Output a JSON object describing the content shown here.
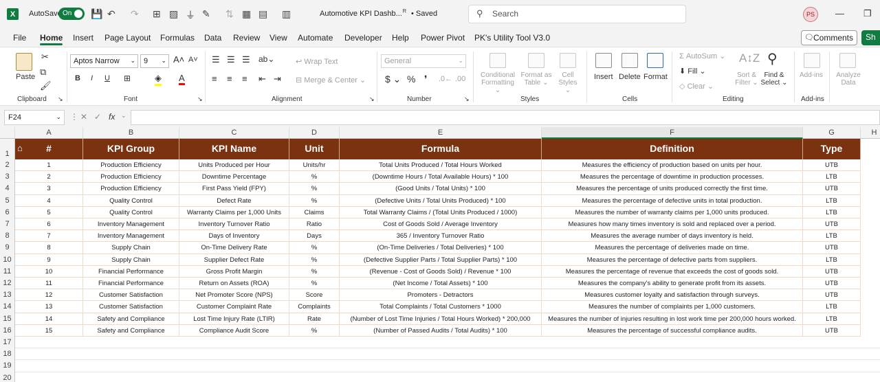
{
  "titlebar": {
    "logo": "X",
    "autosave_label": "AutoSave",
    "autosave_state": "On",
    "document_title": "Automotive KPI Dashb...",
    "saved_status": "• Saved",
    "search_placeholder": "Search",
    "avatar_initials": "PS"
  },
  "menu": [
    "File",
    "Home",
    "Insert",
    "Page Layout",
    "Formulas",
    "Data",
    "Review",
    "View",
    "Automate",
    "Developer",
    "Help",
    "Power Pivot",
    "PK's Utility Tool V3.0"
  ],
  "menu_active": "Home",
  "comments_label": "Comments",
  "share_label": "Sh",
  "ribbon": {
    "paste": "Paste",
    "clipboard": "Clipboard",
    "font_name": "Aptos Narrow",
    "font_size": "9",
    "font": "Font",
    "wrap_text": "Wrap Text",
    "merge_center": "Merge & Center",
    "alignment": "Alignment",
    "number_format": "General",
    "number": "Number",
    "conditional_formatting_1": "Conditional",
    "conditional_formatting_2": "Formatting",
    "format_as_table_1": "Format as",
    "format_as_table_2": "Table",
    "cell_styles_1": "Cell",
    "cell_styles_2": "Styles",
    "styles": "Styles",
    "insert": "Insert",
    "delete": "Delete",
    "format": "Format",
    "cells": "Cells",
    "autosum": "AutoSum",
    "fill": "Fill",
    "clear": "Clear",
    "sort_filter_1": "Sort &",
    "sort_filter_2": "Filter",
    "find_select_1": "Find &",
    "find_select_2": "Select",
    "editing": "Editing",
    "addins": "Add-ins",
    "addins_group": "Add-ins",
    "analyze_1": "Analyze",
    "analyze_2": "Data"
  },
  "namebox": "F24",
  "columns": [
    "A",
    "B",
    "C",
    "D",
    "E",
    "F",
    "G",
    "H"
  ],
  "table_headers": [
    "#",
    "KPI Group",
    "KPI Name",
    "Unit",
    "Formula",
    "Definition",
    "Type"
  ],
  "rows": [
    [
      "1",
      "Production Efficiency",
      "Units Produced per Hour",
      "Units/hr",
      "Total Units Produced / Total Hours Worked",
      "Measures the efficiency of production based on units per hour.",
      "UTB"
    ],
    [
      "2",
      "Production Efficiency",
      "Downtime Percentage",
      "%",
      "(Downtime Hours / Total Available Hours) * 100",
      "Measures the percentage of downtime in production processes.",
      "LTB"
    ],
    [
      "3",
      "Production Efficiency",
      "First Pass Yield (FPY)",
      "%",
      "(Good Units / Total Units) * 100",
      "Measures the percentage of units produced correctly the first time.",
      "UTB"
    ],
    [
      "4",
      "Quality Control",
      "Defect Rate",
      "%",
      "(Defective Units / Total Units Produced) * 100",
      "Measures the percentage of defective units in total production.",
      "LTB"
    ],
    [
      "5",
      "Quality Control",
      "Warranty Claims per 1,000 Units",
      "Claims",
      "Total Warranty Claims / (Total Units Produced / 1000)",
      "Measures the number of warranty claims per 1,000 units produced.",
      "LTB"
    ],
    [
      "6",
      "Inventory Management",
      "Inventory Turnover Ratio",
      "Ratio",
      "Cost of Goods Sold / Average Inventory",
      "Measures how many times inventory is sold and replaced over a period.",
      "UTB"
    ],
    [
      "7",
      "Inventory Management",
      "Days of Inventory",
      "Days",
      "365 / Inventory Turnover Ratio",
      "Measures the average number of days inventory is held.",
      "LTB"
    ],
    [
      "8",
      "Supply Chain",
      "On-Time Delivery Rate",
      "%",
      "(On-Time Deliveries / Total Deliveries) * 100",
      "Measures the percentage of deliveries made on time.",
      "UTB"
    ],
    [
      "9",
      "Supply Chain",
      "Supplier Defect Rate",
      "%",
      "(Defective Supplier Parts / Total Supplier Parts) * 100",
      "Measures the percentage of defective parts from suppliers.",
      "LTB"
    ],
    [
      "10",
      "Financial Performance",
      "Gross Profit Margin",
      "%",
      "(Revenue - Cost of Goods Sold) / Revenue * 100",
      "Measures the percentage of revenue that exceeds the cost of goods sold.",
      "UTB"
    ],
    [
      "11",
      "Financial Performance",
      "Return on Assets (ROA)",
      "%",
      "(Net Income / Total Assets) * 100",
      "Measures the company's ability to generate profit from its assets.",
      "UTB"
    ],
    [
      "12",
      "Customer Satisfaction",
      "Net Promoter Score (NPS)",
      "Score",
      "Promoters - Detractors",
      "Measures customer loyalty and satisfaction through surveys.",
      "UTB"
    ],
    [
      "13",
      "Customer Satisfaction",
      "Customer Complaint Rate",
      "Complaints",
      "Total Complaints / Total Customers * 1000",
      "Measures the number of complaints per 1,000 customers.",
      "LTB"
    ],
    [
      "14",
      "Safety and Compliance",
      "Lost Time Injury Rate (LTIR)",
      "Rate",
      "(Number of Lost Time Injuries / Total Hours Worked) * 200,000",
      "Measures the number of injuries resulting in lost work time per 200,000 hours worked.",
      "LTB"
    ],
    [
      "15",
      "Safety and Compliance",
      "Compliance Audit Score",
      "%",
      "(Number of Passed Audits / Total Audits) * 100",
      "Measures the percentage of successful compliance audits.",
      "UTB"
    ]
  ],
  "row_numbers": [
    "1",
    "2",
    "3",
    "4",
    "5",
    "6",
    "7",
    "8",
    "9",
    "10",
    "11",
    "12",
    "13",
    "14",
    "15",
    "16",
    "17",
    "18",
    "19",
    "20"
  ],
  "colors": {
    "header_bg": "#7a3211",
    "accent": "#107c41"
  }
}
